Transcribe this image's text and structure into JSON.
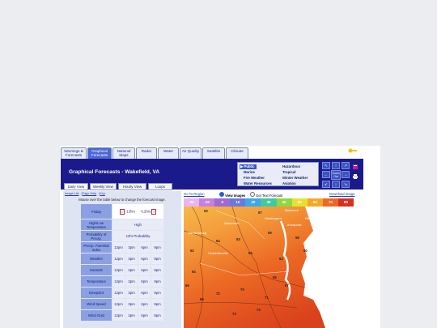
{
  "tabs": [
    "Warnings & Forecasts",
    "Graphical Forecasts",
    "National Maps",
    "Radar",
    "Water",
    "Air Quality",
    "Satellite",
    "Climate"
  ],
  "banner": {
    "title": "Graphical Forecasts - Wakefield, VA",
    "categories": [
      "Public",
      "Hazardous",
      "Marine",
      "Tropical",
      "Fire Weather",
      "Winter Weather",
      "Water Resources",
      "Aviation"
    ],
    "zoom_label": "Zoom Out"
  },
  "subtabs": [
    "Daily View",
    "Weekly View",
    "Hourly View",
    "Loops"
  ],
  "left": {
    "links": [
      "Image List",
      "Page Help",
      "Key"
    ],
    "instruction": "Mouse over the table below to change the forecast image.",
    "day": "Friday",
    "prev": "-12hrs",
    "next": "+12hrs",
    "rows": [
      {
        "label": "High/Low Temperature",
        "value": "High"
      },
      {
        "label": "Probability of Precip.",
        "value": "12hr Probability"
      },
      {
        "label": "Precip. Potential Index",
        "times": [
          "12pm",
          "3pm",
          "6pm",
          "9pm"
        ]
      },
      {
        "label": "Weather",
        "times": [
          "12pm",
          "3pm",
          "6pm",
          "9pm"
        ]
      },
      {
        "label": "Hazards",
        "times": [
          "12pm",
          "3pm",
          "6pm",
          "9pm"
        ]
      },
      {
        "label": "Temperature",
        "times": [
          "12pm",
          "3pm",
          "6pm",
          "9pm"
        ]
      },
      {
        "label": "Dewpoint",
        "times": [
          "12pm",
          "3pm",
          "6pm",
          "9pm"
        ]
      },
      {
        "label": "Wind Speed",
        "times": [
          "12pm",
          "3pm",
          "6pm",
          "9pm"
        ]
      },
      {
        "label": "Wind Gust",
        "times": [
          "12pm",
          "3pm",
          "6pm",
          "9pm"
        ]
      }
    ]
  },
  "mapheader": {
    "goto": "Go To Region",
    "view_images": "View Images",
    "get_text": "Get Text Forecast",
    "download": "Download Image"
  },
  "colorbar": [
    "-20",
    "-10",
    "0",
    "10",
    "20",
    "30",
    "40",
    "50",
    "60",
    "70",
    "80"
  ],
  "map": {
    "cities": [
      "Harrisonburg",
      "Charlottesville",
      "Warrenton",
      "Washington",
      "Baltimore",
      "Annapolis",
      "Rehoboth Beach"
    ],
    "temps": [
      "53",
      "53",
      "52",
      "54",
      "55",
      "57",
      "58",
      "59",
      "60",
      "62",
      "64",
      "65",
      "66",
      "67",
      "68",
      "70",
      "71",
      "72",
      "73",
      "74"
    ]
  },
  "colors": {
    "banner": "#1a1a8c",
    "accent": "#4a66d8",
    "label_cell": "#8ba0e2"
  }
}
